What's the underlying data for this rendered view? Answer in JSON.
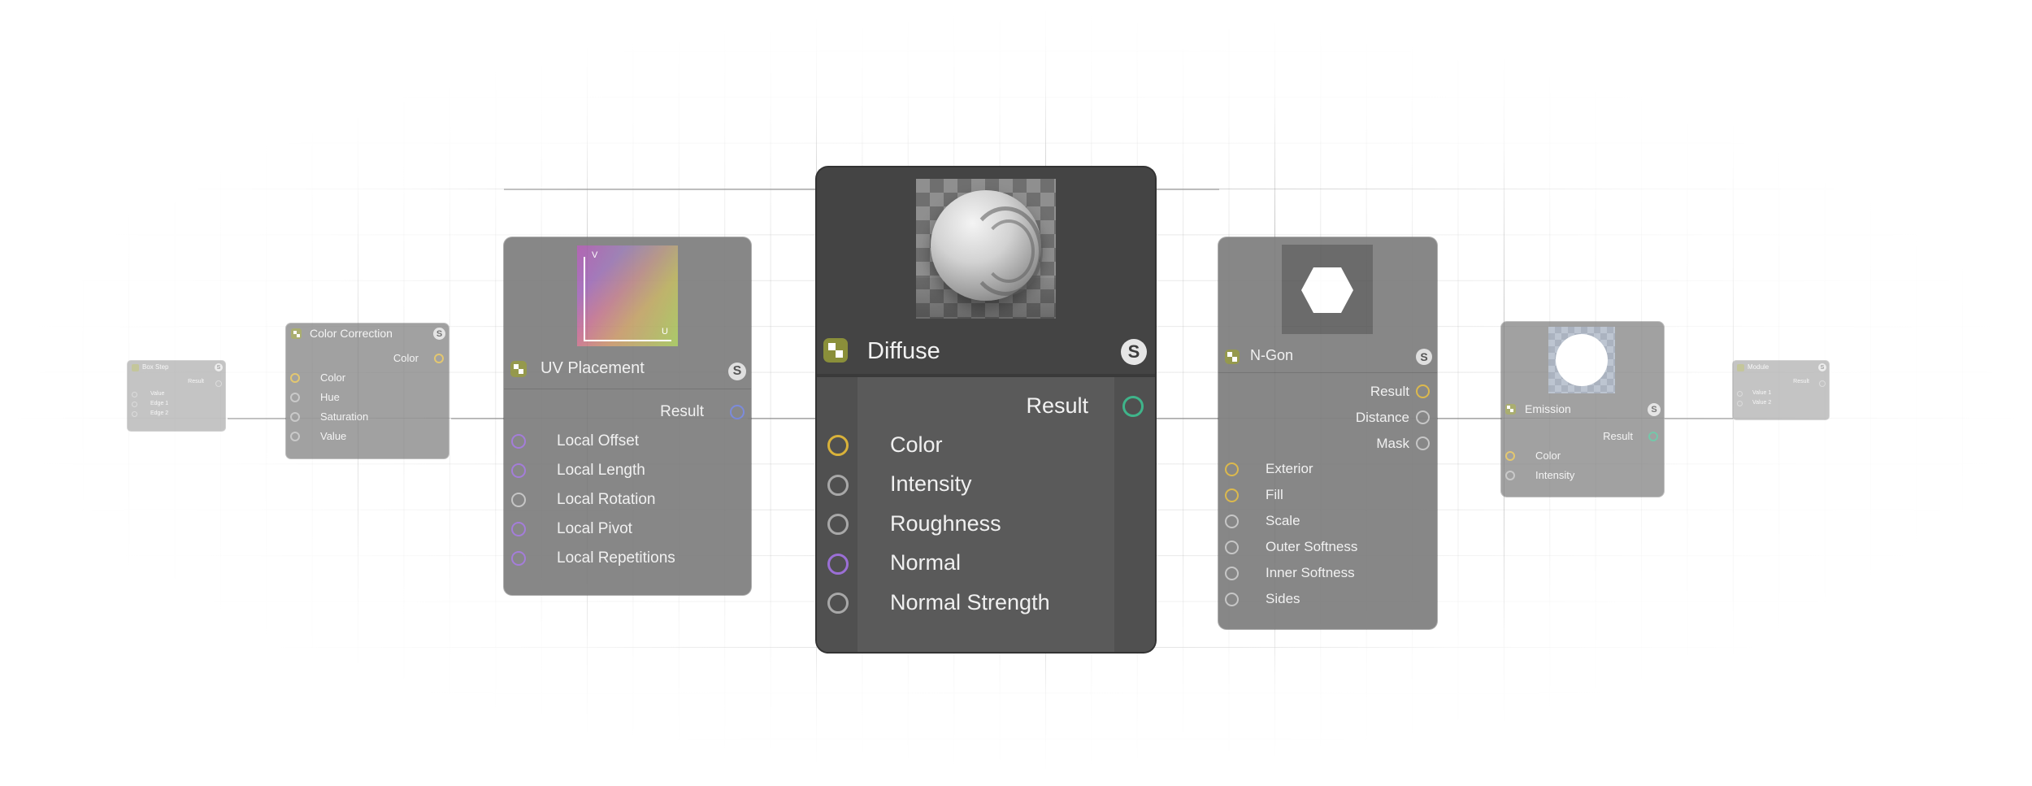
{
  "nodes": {
    "box_step": {
      "title": "Box Step",
      "output": "Result",
      "inputs": [
        "Value",
        "Edge 1",
        "Edge 2"
      ]
    },
    "color_correction": {
      "title": "Color Correction",
      "output": "Color",
      "inputs": [
        "Color",
        "Hue",
        "Saturation",
        "Value"
      ]
    },
    "uv_placement": {
      "title": "UV Placement",
      "preview_axis_v": "V",
      "preview_axis_u": "U",
      "output": "Result",
      "inputs": [
        "Local Offset",
        "Local Length",
        "Local Rotation",
        "Local Pivot",
        "Local Repetitions"
      ]
    },
    "diffuse": {
      "title": "Diffuse",
      "output": "Result",
      "inputs": [
        "Color",
        "Intensity",
        "Roughness",
        "Normal",
        "Normal Strength"
      ]
    },
    "n_gon": {
      "title": "N-Gon",
      "outputs": [
        "Result",
        "Distance",
        "Mask"
      ],
      "inputs": [
        "Exterior",
        "Fill",
        "Scale",
        "Outer Softness",
        "Inner Softness",
        "Sides"
      ]
    },
    "emission": {
      "title": "Emission",
      "output": "Result",
      "inputs": [
        "Color",
        "Intensity"
      ]
    },
    "module": {
      "title": "Module",
      "output": "Result",
      "inputs": [
        "Value 1",
        "Value 2"
      ]
    }
  },
  "badge_letter": "S",
  "port_colors": {
    "color": "#d9b23a",
    "gray": "#8c8c8c",
    "purple": "#9b6fd6",
    "blue": "#6e7fd8",
    "green": "#3fb48a"
  }
}
